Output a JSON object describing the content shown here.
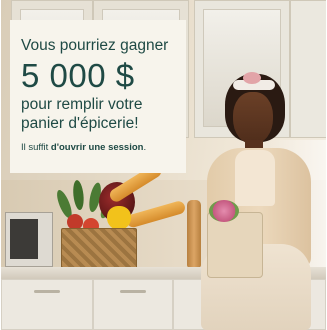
{
  "ad": {
    "headline_line1": "Vous pourriez gagner",
    "amount": "5 000 $",
    "headline_line3": "pour remplir votre",
    "headline_line4": "panier d'épicerie!",
    "cta_prefix": "Il suffit ",
    "cta_bold": "d'ouvrir une session",
    "cta_suffix": "."
  },
  "colors": {
    "text": "#1f4a45",
    "card_background": "#f7f4ec"
  },
  "image": {
    "subject": "kitchen-photo"
  }
}
